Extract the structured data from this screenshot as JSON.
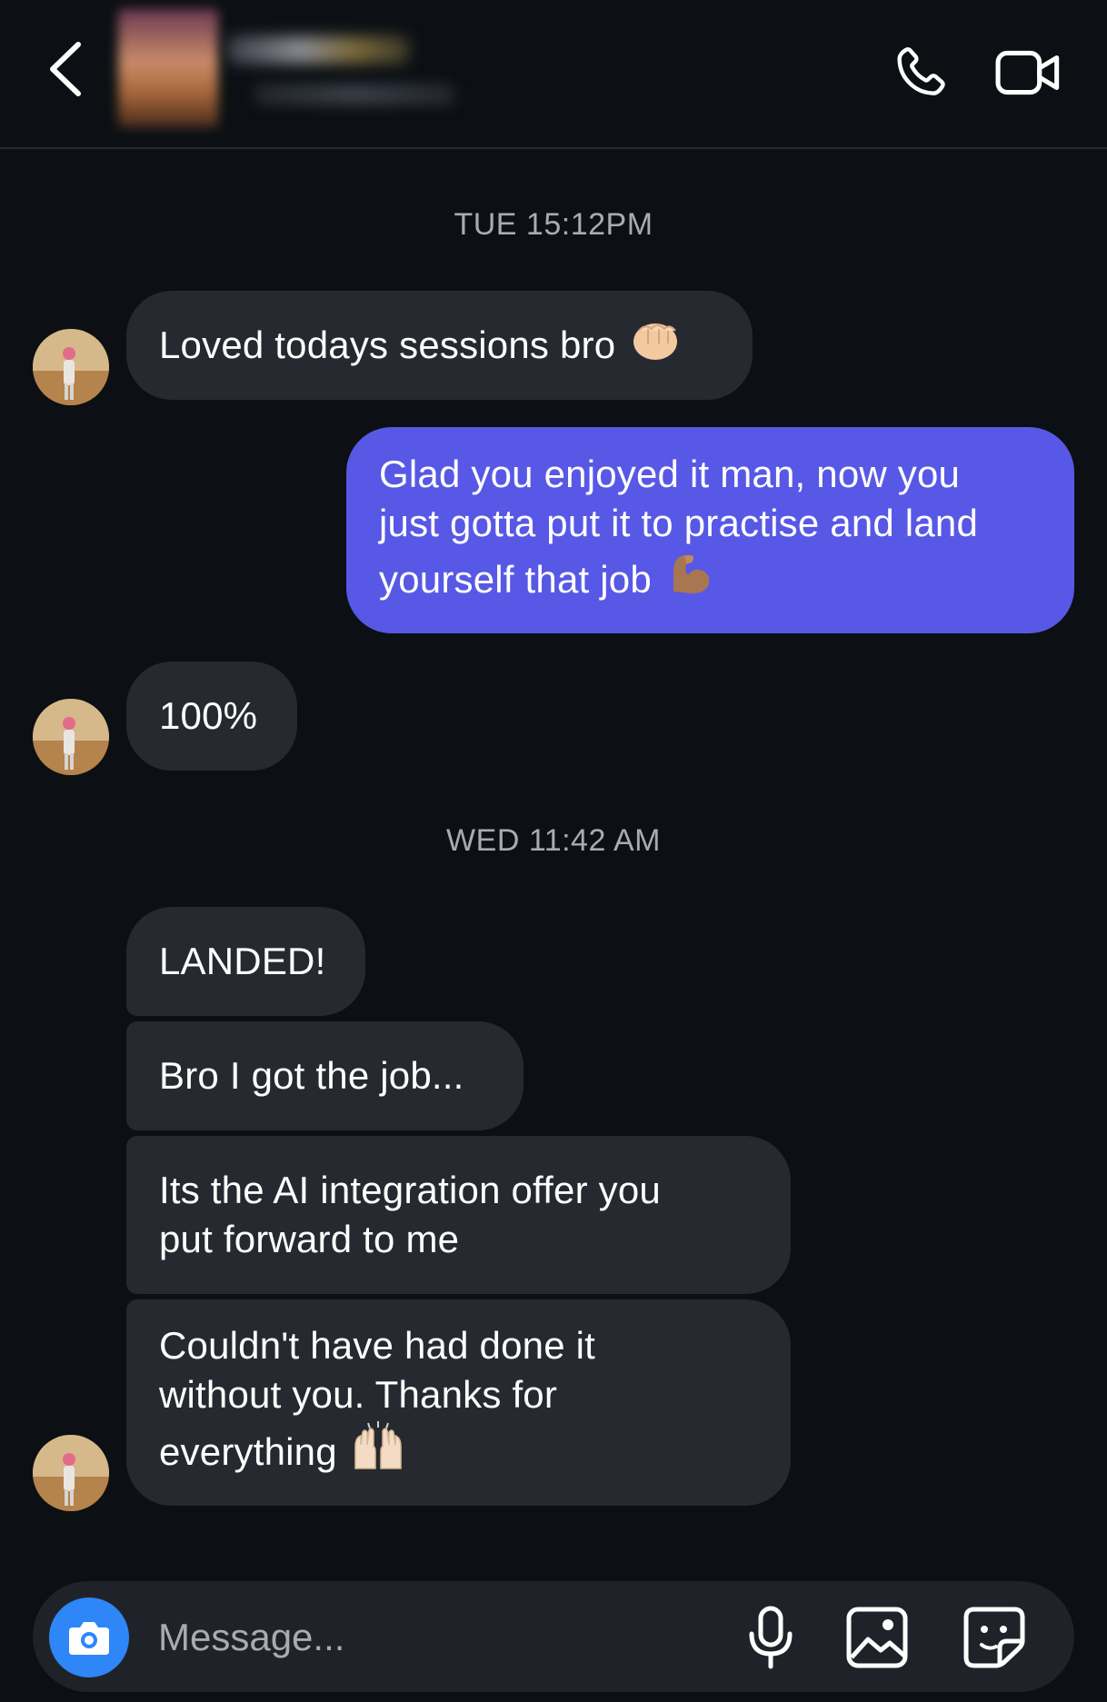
{
  "header": {
    "contact_name": "",
    "contact_status": ""
  },
  "thread": {
    "timestamps": [
      "TUE 15:12PM",
      "WED 11:42 AM"
    ],
    "messages": [
      {
        "direction": "in",
        "text": "Loved todays sessions bro",
        "emoji": "fist-bump-emoji"
      },
      {
        "direction": "out",
        "line1": "Glad you enjoyed it man, now you",
        "line2": "just gotta put it to practise and land",
        "line3": "yourself that job",
        "emoji": "flexed-biceps-emoji"
      },
      {
        "direction": "in",
        "text": "100%"
      },
      {
        "direction": "in",
        "text": "LANDED!"
      },
      {
        "direction": "in",
        "text": "Bro I got the job..."
      },
      {
        "direction": "in",
        "line1": "Its the AI integration offer you",
        "line2": "put forward to me"
      },
      {
        "direction": "in",
        "line1": "Couldn't have had done it",
        "line2": "without you. Thanks for",
        "line3": "everything",
        "emoji": "raising-hands-emoji"
      }
    ]
  },
  "composer": {
    "placeholder": "Message..."
  },
  "icons": {
    "back": "chevron-left-icon",
    "call": "phone-icon",
    "video": "video-camera-icon",
    "camera": "camera-icon",
    "mic": "microphone-icon",
    "gallery": "image-icon",
    "sticker": "sticker-icon"
  },
  "colors": {
    "background": "#0c1014",
    "incoming_bubble": "#262a30",
    "outgoing_bubble": "#5858e6",
    "camera_button": "#2f86f6",
    "muted_text": "#a8abb1"
  }
}
